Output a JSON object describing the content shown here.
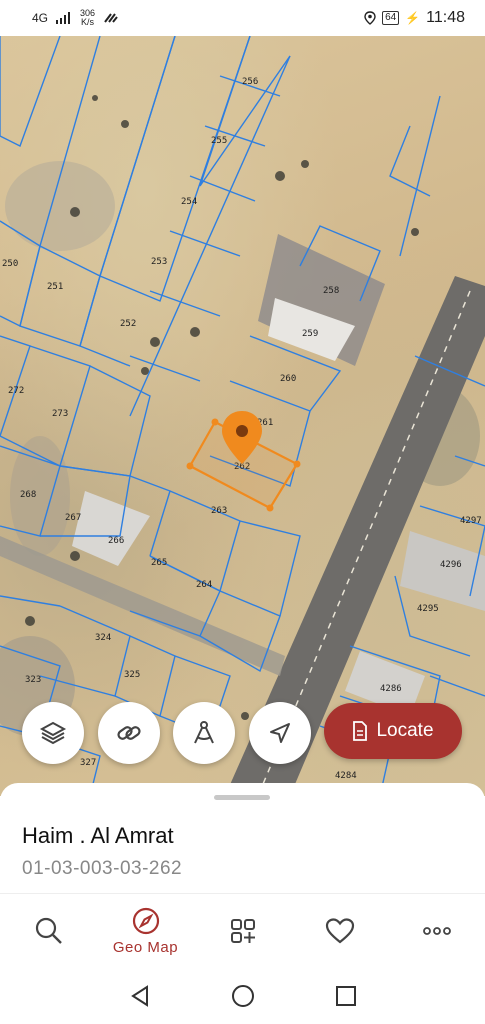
{
  "status": {
    "signal": "4G",
    "net_speed_value": "306",
    "net_speed_unit": "K/s",
    "battery": "64",
    "time": "11:48"
  },
  "map": {
    "selected_plot": "262",
    "plot_labels": [
      "256",
      "255",
      "254",
      "253",
      "252",
      "251",
      "250",
      "258",
      "259",
      "260",
      "261",
      "262",
      "263",
      "264",
      "265",
      "266",
      "267",
      "268",
      "272",
      "273",
      "4297",
      "4296",
      "4295",
      "4286",
      "4284",
      "324",
      "325",
      "323",
      "327"
    ],
    "colors": {
      "plot_lines": "#2f7fe0",
      "selection": "#f08a1e",
      "pin": "#f08a1e"
    }
  },
  "fabs": {
    "layers_icon": "layers-icon",
    "link_icon": "link-icon",
    "measure_icon": "compass-measure-icon",
    "navigate_icon": "navigation-arrow-icon"
  },
  "locate_button": {
    "label": "Locate",
    "icon": "document-icon",
    "color": "#a8332f"
  },
  "sheet": {
    "title": "Haim . Al Amrat",
    "plot_id": "01-03-003-03-262"
  },
  "bottom_nav": {
    "items": [
      {
        "icon": "search-icon",
        "label": ""
      },
      {
        "icon": "compass-icon",
        "label": "Geo Map"
      },
      {
        "icon": "grid-add-icon",
        "label": ""
      },
      {
        "icon": "heart-icon",
        "label": ""
      },
      {
        "icon": "more-icon",
        "label": ""
      }
    ],
    "active_color": "#a8332f"
  }
}
